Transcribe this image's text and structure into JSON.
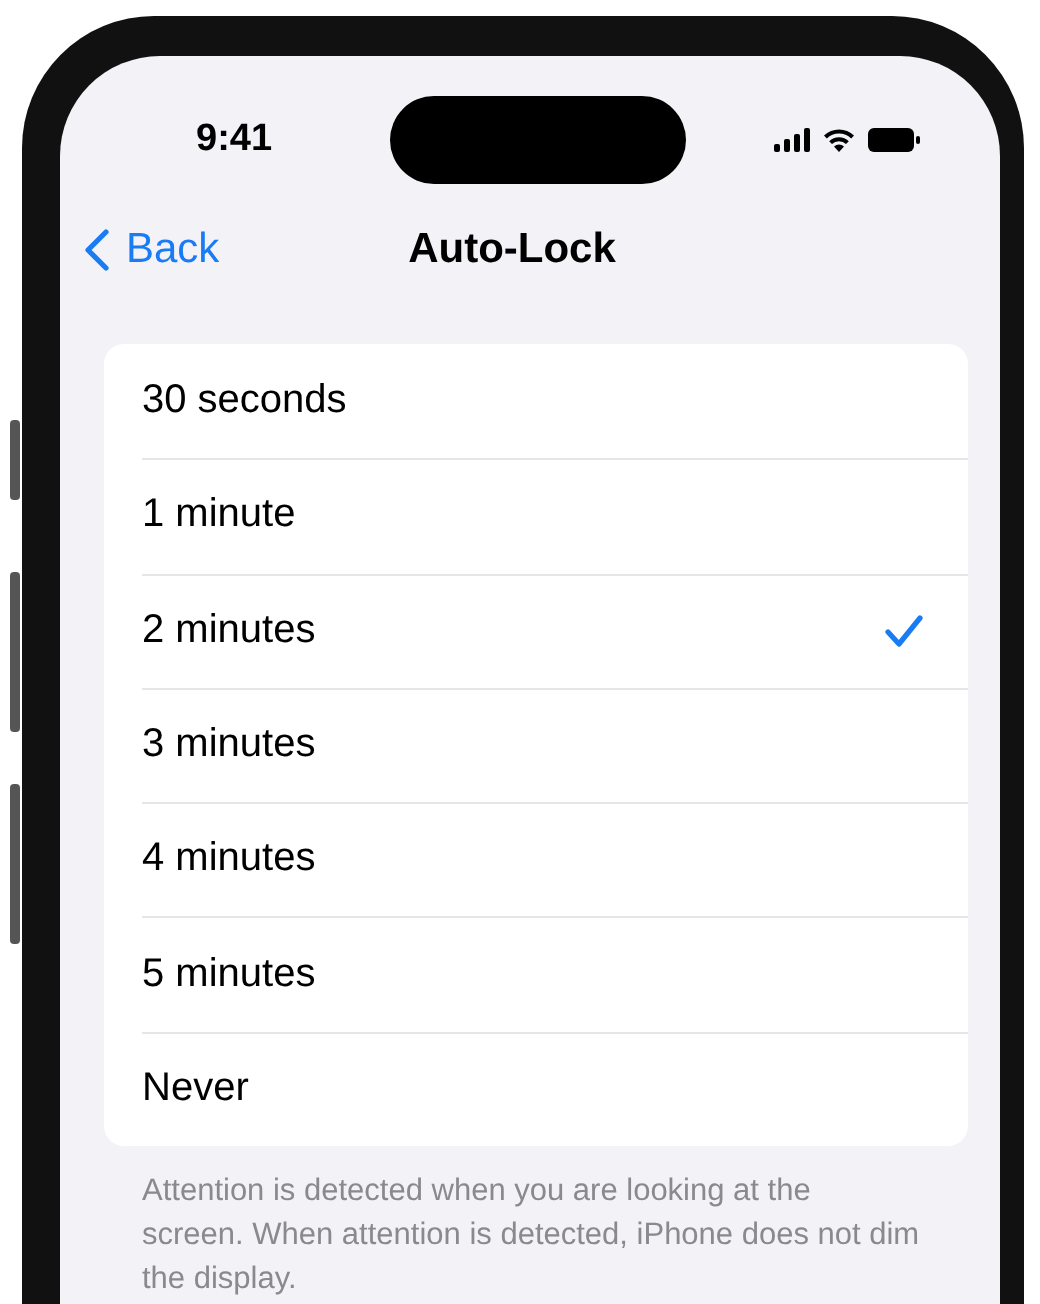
{
  "status_bar": {
    "time": "9:41"
  },
  "nav": {
    "back": "Back",
    "title": "Auto-Lock"
  },
  "options": [
    {
      "label": "30 seconds",
      "selected": false
    },
    {
      "label": "1 minute",
      "selected": false
    },
    {
      "label": "2 minutes",
      "selected": true
    },
    {
      "label": "3 minutes",
      "selected": false
    },
    {
      "label": "4 minutes",
      "selected": false
    },
    {
      "label": "5 minutes",
      "selected": false
    },
    {
      "label": "Never",
      "selected": false
    }
  ],
  "footer": "Attention is detected when you are looking at the screen. When attention is detected, iPhone does not dim the display."
}
